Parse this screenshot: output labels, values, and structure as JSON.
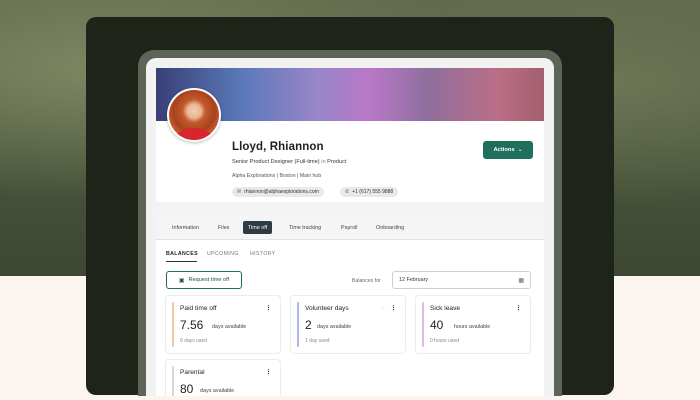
{
  "profile": {
    "name": "Lloyd, Rhiannon",
    "title": "Senior Product Designer (Full-time)",
    "title_sep": "in",
    "department": "Product",
    "location": "Alpha Explorations | Boston | Main hub",
    "email": "rhiannon@alphaexplorations.com",
    "phone": "+1 (617) 555 9888",
    "actions_label": "Actions"
  },
  "tabs": [
    "Information",
    "Files",
    "Time off",
    "Time tracking",
    "Payroll",
    "Onboarding"
  ],
  "active_tab": "Time off",
  "subtabs": [
    "BALANCES",
    "UPCOMING",
    "HISTORY"
  ],
  "active_subtab": "BALANCES",
  "request_button": "Request time off",
  "balances_for_label": "Balances for",
  "balances_date": "12 February",
  "tiles": [
    {
      "title": "Paid time off",
      "value": "7.56",
      "unit": "days available",
      "used": "9 days used",
      "color": "#f3c7a0"
    },
    {
      "title": "Volunteer days",
      "value": "2",
      "unit": "days available",
      "used": "1 day used",
      "color": "#a9b7e4"
    },
    {
      "title": "Sick leave",
      "value": "40",
      "unit": "hours available",
      "used": "0 hours used",
      "color": "#e6b4ec"
    },
    {
      "title": "Parental",
      "value": "80",
      "unit": "days available",
      "used": "",
      "color": "#d7d7d7"
    }
  ],
  "colors": {
    "accent": "#1f6f5d",
    "active_tab_bg": "#2f3b44"
  }
}
